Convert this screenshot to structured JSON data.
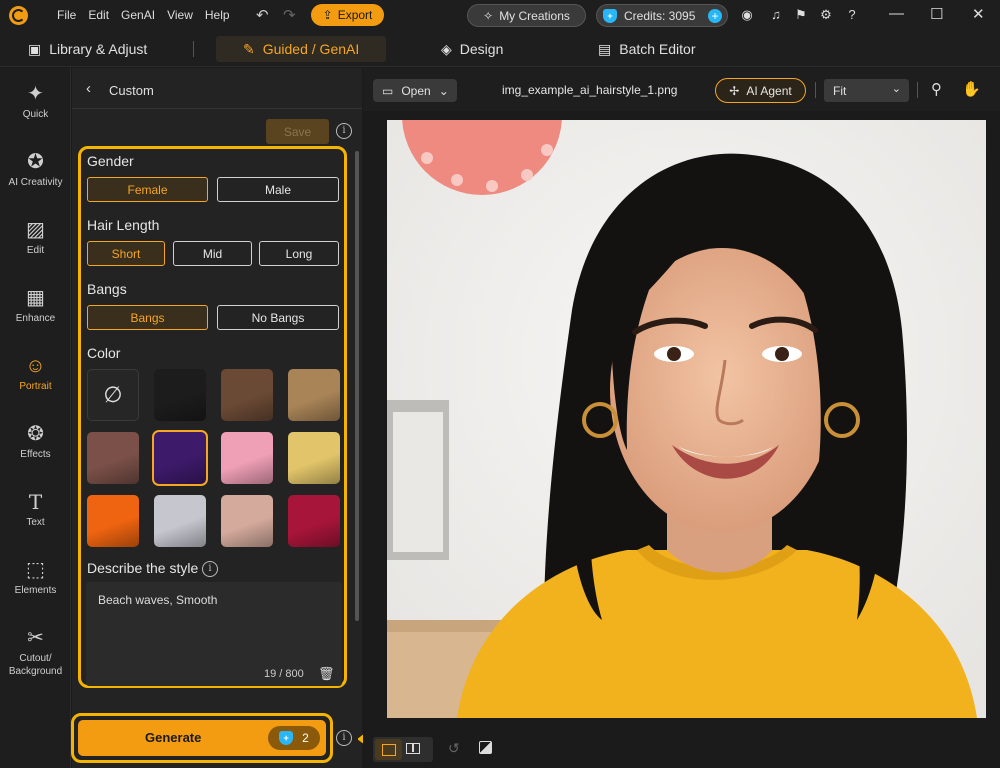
{
  "menu": [
    "File",
    "Edit",
    "GenAI",
    "View",
    "Help"
  ],
  "toolbar": {
    "export_label": "Export",
    "my_creations_label": "My Creations",
    "credits_label": "Credits: 3095"
  },
  "modes": {
    "library": "Library & Adjust",
    "guided": "Guided / GenAI",
    "design": "Design",
    "batch": "Batch Editor"
  },
  "sidebar": {
    "items": [
      {
        "label": "Quick",
        "icon": "magic-wand-icon"
      },
      {
        "label": "AI Creativity",
        "icon": "ai-creativity-icon"
      },
      {
        "label": "Edit",
        "icon": "edit-icon"
      },
      {
        "label": "Enhance",
        "icon": "enhance-icon"
      },
      {
        "label": "Portrait",
        "icon": "portrait-icon"
      },
      {
        "label": "Effects",
        "icon": "effects-icon"
      },
      {
        "label": "Text",
        "icon": "text-icon"
      },
      {
        "label": "Elements",
        "icon": "elements-icon"
      },
      {
        "label": "Cutout/",
        "label2": "Background",
        "icon": "cutout-icon"
      }
    ]
  },
  "panel": {
    "title": "Custom",
    "save_label": "Save",
    "gender": {
      "label": "Gender",
      "options": [
        "Female",
        "Male"
      ],
      "selected": "Female"
    },
    "hair_length": {
      "label": "Hair Length",
      "options": [
        "Short",
        "Mid",
        "Long"
      ],
      "selected": "Short"
    },
    "bangs": {
      "label": "Bangs",
      "options": [
        "Bangs",
        "No Bangs"
      ],
      "selected": "Bangs"
    },
    "color": {
      "label": "Color",
      "swatches": [
        "none",
        "#1c1c1c",
        "#6b4a35",
        "#a98457",
        "#7a5048",
        "#3d1a6a",
        "#ef9fb6",
        "#e2c56a",
        "#ef6410",
        "#c6c6cf",
        "#d4aa9c",
        "#a8153a"
      ],
      "selected_index": 5
    },
    "describe": {
      "label": "Describe the style",
      "value": "Beach waves, Smooth",
      "count": "19 / 800"
    },
    "generate_label": "Generate",
    "generate_cost": "2"
  },
  "canvas": {
    "open_label": "Open",
    "filename": "img_example_ai_hairstyle_1.png",
    "agent_label": "AI Agent",
    "zoom_label": "Fit"
  }
}
